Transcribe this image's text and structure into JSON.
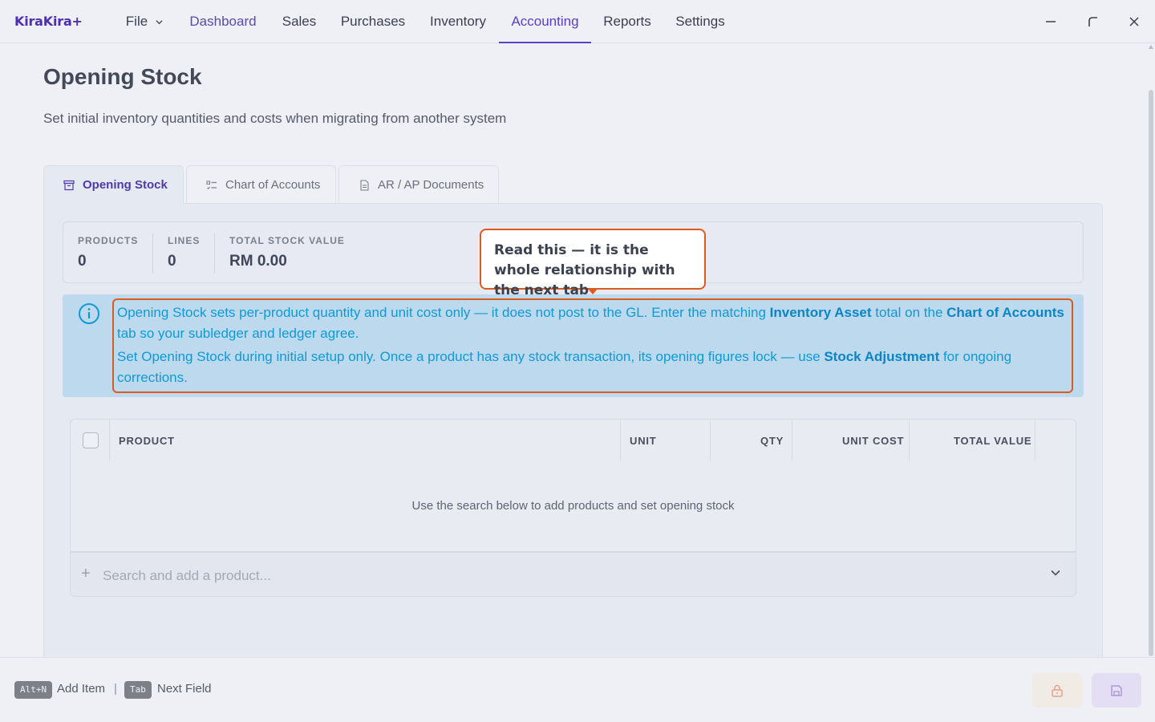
{
  "app": {
    "brand": "KiraKira+"
  },
  "nav": {
    "file": "File",
    "items": [
      "Dashboard",
      "Sales",
      "Purchases",
      "Inventory",
      "Accounting",
      "Reports",
      "Settings"
    ],
    "active": "Accounting"
  },
  "page": {
    "title": "Opening Stock",
    "subtitle": "Set initial inventory quantities and costs when migrating from another system"
  },
  "tabs": [
    {
      "label": "Opening Stock",
      "icon": "archive-icon"
    },
    {
      "label": "Chart of Accounts",
      "icon": "list-icon"
    },
    {
      "label": "AR / AP Documents",
      "icon": "document-icon"
    }
  ],
  "stats": [
    {
      "label": "PRODUCTS",
      "value": "0"
    },
    {
      "label": "LINES",
      "value": "0"
    },
    {
      "label": "TOTAL STOCK VALUE",
      "value": "RM 0.00"
    }
  ],
  "callout": {
    "text": "Read this — it is the whole relationship with the next tab"
  },
  "info": {
    "line1_a": "Opening Stock sets per-product quantity and unit cost only — it does not post to the GL. Enter the matching ",
    "line1_b": "Inventory Asset",
    "line1_c": " total on the ",
    "line1_d": "Chart of Accounts",
    "line1_e": " tab so your subledger and ledger agree.",
    "line2_a": "Set Opening Stock during initial setup only. Once a product has any stock transaction, its opening figures lock — use ",
    "line2_b": "Stock Adjustment",
    "line2_c": " for ongoing corrections."
  },
  "table": {
    "columns": [
      "PRODUCT",
      "UNIT",
      "QTY",
      "UNIT COST",
      "TOTAL VALUE"
    ],
    "rows": [],
    "empty_message": "Use the search below to add products and set opening stock"
  },
  "search": {
    "placeholder": "Search and add a product..."
  },
  "footer": {
    "shortcuts": [
      {
        "key": "Alt+N",
        "label": "Add Item"
      },
      {
        "key": "Tab",
        "label": "Next Field"
      }
    ],
    "separator": "|"
  },
  "colors": {
    "accent": "#5b3fc0",
    "info_bg": "#bcd9ee",
    "info_text": "#0f9ad6",
    "highlight": "#dc5a1e"
  }
}
